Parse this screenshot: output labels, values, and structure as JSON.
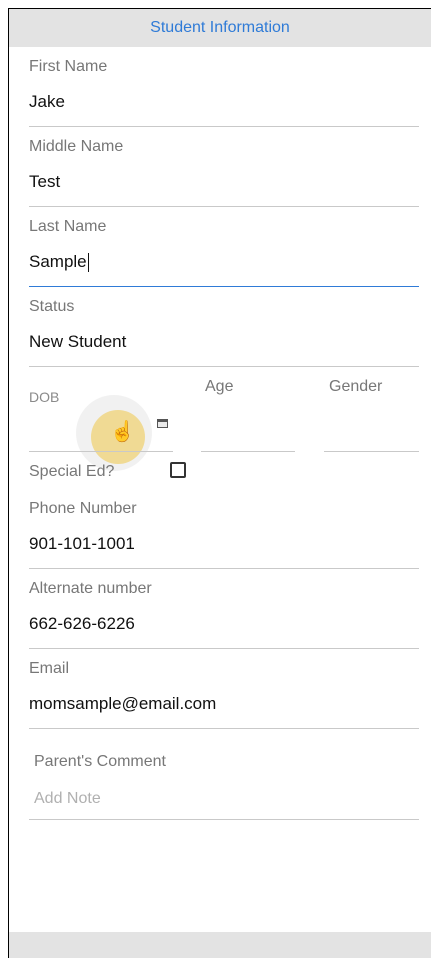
{
  "header": {
    "title": "Student Information"
  },
  "fields": {
    "first_name": {
      "label": "First Name",
      "value": "Jake"
    },
    "middle_name": {
      "label": "Middle Name",
      "value": "Test"
    },
    "last_name": {
      "label": "Last Name",
      "value": "Sample"
    },
    "status": {
      "label": "Status",
      "value": "New Student"
    },
    "dob": {
      "label": "DOB",
      "icon": "calendar-icon"
    },
    "age": {
      "label": "Age"
    },
    "gender": {
      "label": "Gender"
    },
    "special_ed": {
      "label": "Special Ed?",
      "checked": false
    },
    "phone": {
      "label": "Phone Number",
      "value": "901-101-1001"
    },
    "alternate": {
      "label": "Alternate number",
      "value": "662-626-6226"
    },
    "email": {
      "label": "Email",
      "value": "momsample@email.com"
    },
    "comment": {
      "label": "Parent's Comment",
      "placeholder": "Add Note"
    }
  },
  "colors": {
    "accent": "#2f7bd7",
    "header_bg": "#e3e3e3"
  }
}
